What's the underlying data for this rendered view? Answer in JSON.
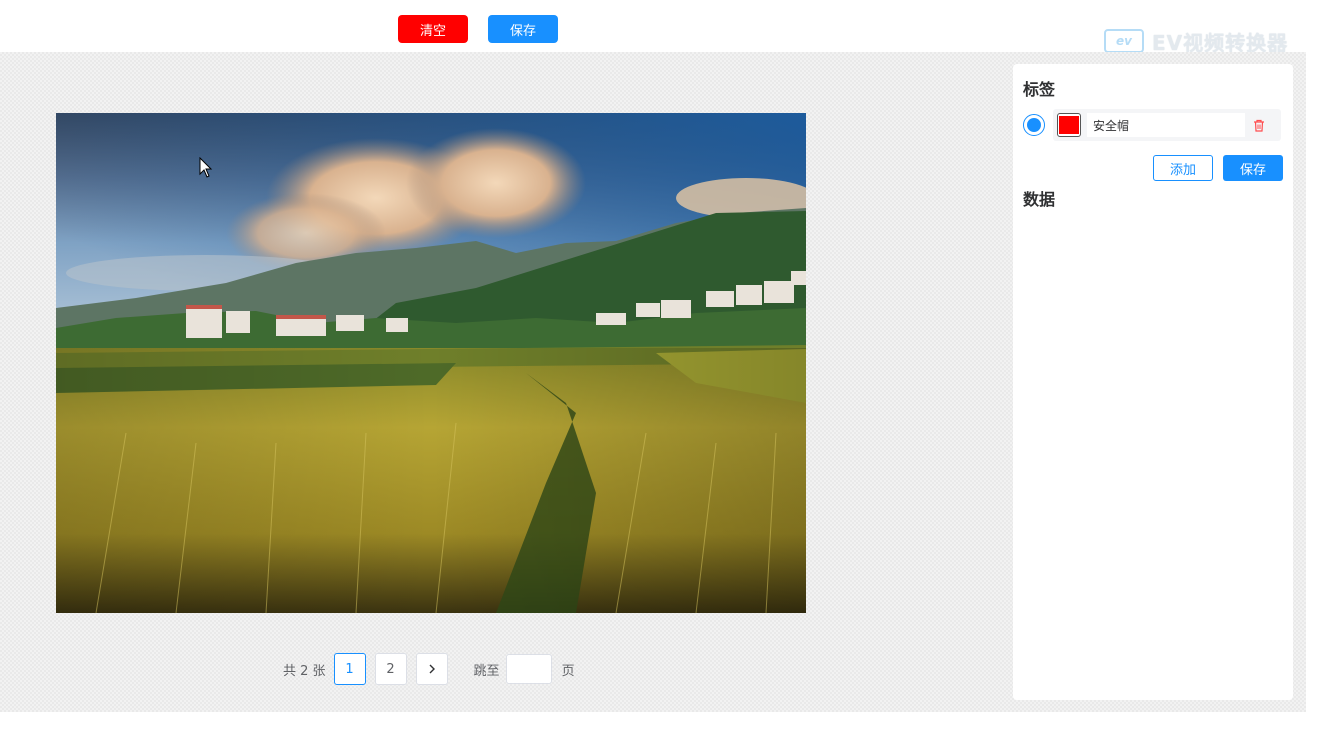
{
  "toolbar": {
    "clear_label": "清空",
    "save_label": "保存"
  },
  "watermark": {
    "logo_text": "ev",
    "text": "EV视频转换器"
  },
  "pagination": {
    "total_text": "共 2 张",
    "pages": [
      "1",
      "2"
    ],
    "current_page": "1",
    "next_symbol": ">",
    "jump_label": "跳至",
    "jump_value": "",
    "page_suffix": "页"
  },
  "panel": {
    "labels_title": "标签",
    "label_items": [
      {
        "name": "安全帽",
        "color": "#ff0000",
        "selected": true
      }
    ],
    "add_label": "添加",
    "save_label": "保存",
    "data_title": "数据"
  },
  "colors": {
    "primary": "#1890ff",
    "danger": "#ff0000"
  }
}
